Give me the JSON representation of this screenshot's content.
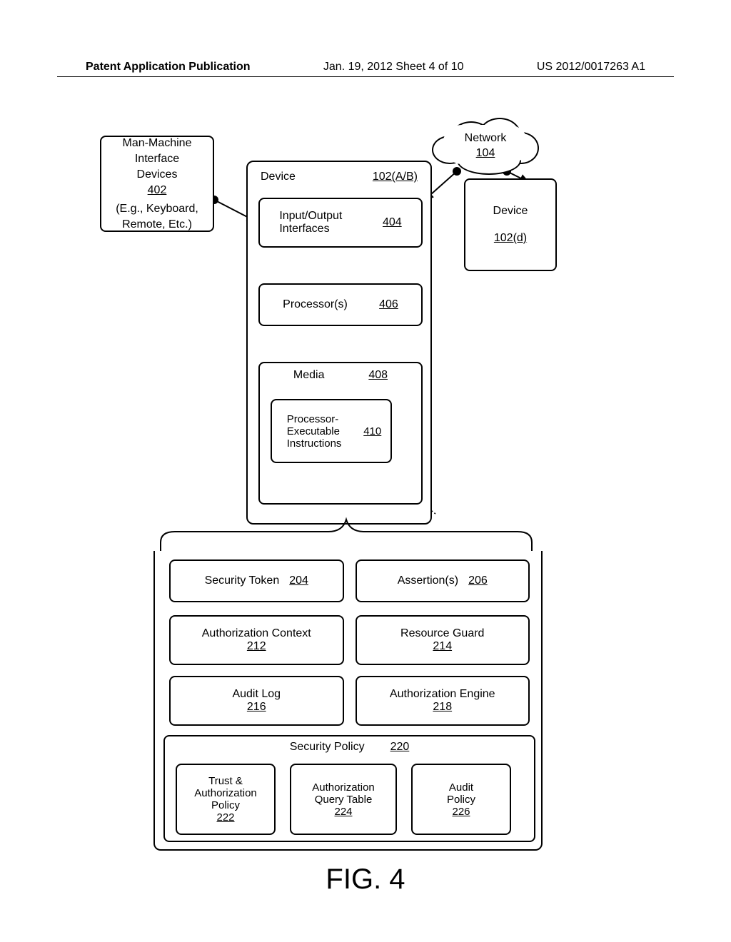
{
  "header": {
    "left": "Patent Application Publication",
    "center": "Jan. 19, 2012  Sheet 4 of 10",
    "right": "US 2012/0017263 A1"
  },
  "cloud": {
    "label": "Network",
    "ref": "104"
  },
  "mm_box": {
    "l1": "Man-Machine",
    "l2": "Interface",
    "l3": "Devices",
    "ref": "402",
    "l4": "(E.g., Keyboard,",
    "l5": "Remote, Etc.)"
  },
  "device_ab": {
    "label": "Device",
    "ref": "102(A/B)",
    "io": {
      "label": "Input/Output Interfaces",
      "ref": "404"
    },
    "proc": {
      "label": "Processor(s)",
      "ref": "406"
    },
    "media": {
      "label": "Media",
      "ref": "408"
    },
    "pei": {
      "label": "Processor-Executable Instructions",
      "ref": "410"
    }
  },
  "device_d": {
    "label": "Device",
    "ref": "102(d)"
  },
  "lower": {
    "sec_token": {
      "label": "Security Token",
      "ref": "204"
    },
    "assertions": {
      "label": "Assertion(s)",
      "ref": "206"
    },
    "auth_ctx": {
      "label": "Authorization Context",
      "ref": "212"
    },
    "res_guard": {
      "label": "Resource Guard",
      "ref": "214"
    },
    "audit_log": {
      "label": "Audit Log",
      "ref": "216"
    },
    "auth_eng": {
      "label": "Authorization Engine",
      "ref": "218"
    },
    "sec_policy": {
      "label": "Security Policy",
      "ref": "220"
    },
    "trust": {
      "l1": "Trust &",
      "l2": "Authorization",
      "l3": "Policy",
      "ref": "222"
    },
    "aqt": {
      "l1": "Authorization",
      "l2": "Query Table",
      "ref": "224"
    },
    "audit_pol": {
      "l1": "Audit",
      "l2": "Policy",
      "ref": "226"
    }
  },
  "fig": "FIG. 4"
}
